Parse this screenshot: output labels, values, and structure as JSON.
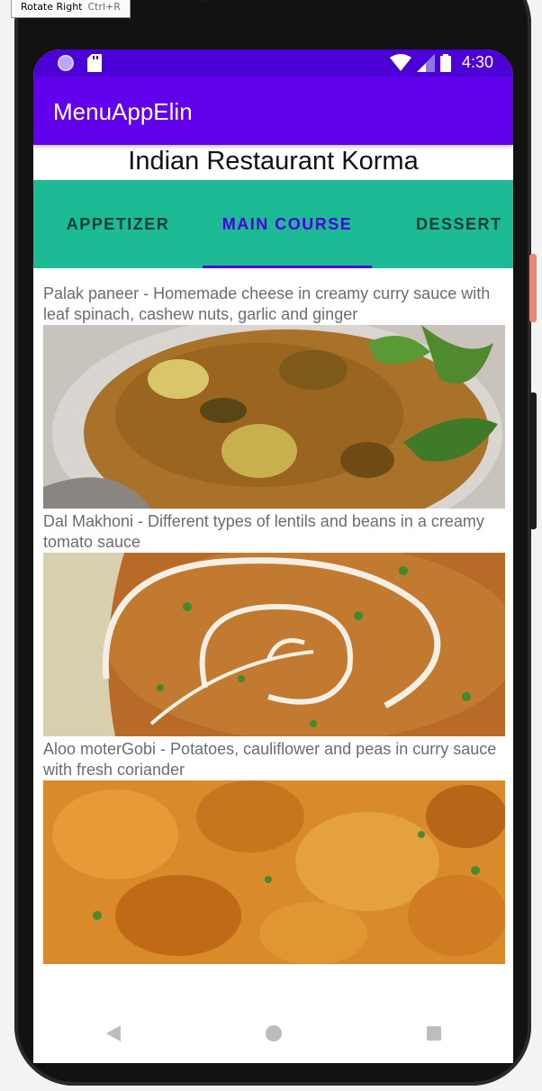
{
  "tooltip": {
    "label": "Rotate Right",
    "shortcut": "Ctrl+R"
  },
  "status_bar": {
    "time": "4:30",
    "icons": [
      "notification-dot-icon",
      "sd-card-icon",
      "wifi-icon",
      "cell-signal-icon",
      "battery-icon"
    ]
  },
  "app_bar": {
    "title": "MenuAppElin"
  },
  "restaurant_title": "Indian Restaurant Korma",
  "tabs": [
    {
      "label": "APPETIZER",
      "active": false
    },
    {
      "label": "MAIN COURSE",
      "active": true
    },
    {
      "label": "DESSERT",
      "active": false
    }
  ],
  "menu_items": [
    {
      "description": "Palak paneer - Homemade cheese in creamy curry sauce with leaf spinach, cashew nuts, garlic and ginger",
      "image": "palak-paneer-photo"
    },
    {
      "description": "Dal Makhoni - Different types of lentils and beans in a creamy tomato sauce",
      "image": "dal-makhoni-photo"
    },
    {
      "description": "Aloo moterGobi - Potatoes, cauliflower and peas in curry sauce with fresh coriander",
      "image": "aloo-gobi-photo"
    }
  ],
  "nav_bar": {
    "buttons": [
      "back-icon",
      "home-icon",
      "recents-icon"
    ]
  },
  "colors": {
    "status_bar": "#4a02d6",
    "app_bar": "#6200ee",
    "tab_bar": "#1dba96",
    "tab_active": "#4a00e0",
    "tab_inactive": "#0f3d33"
  }
}
